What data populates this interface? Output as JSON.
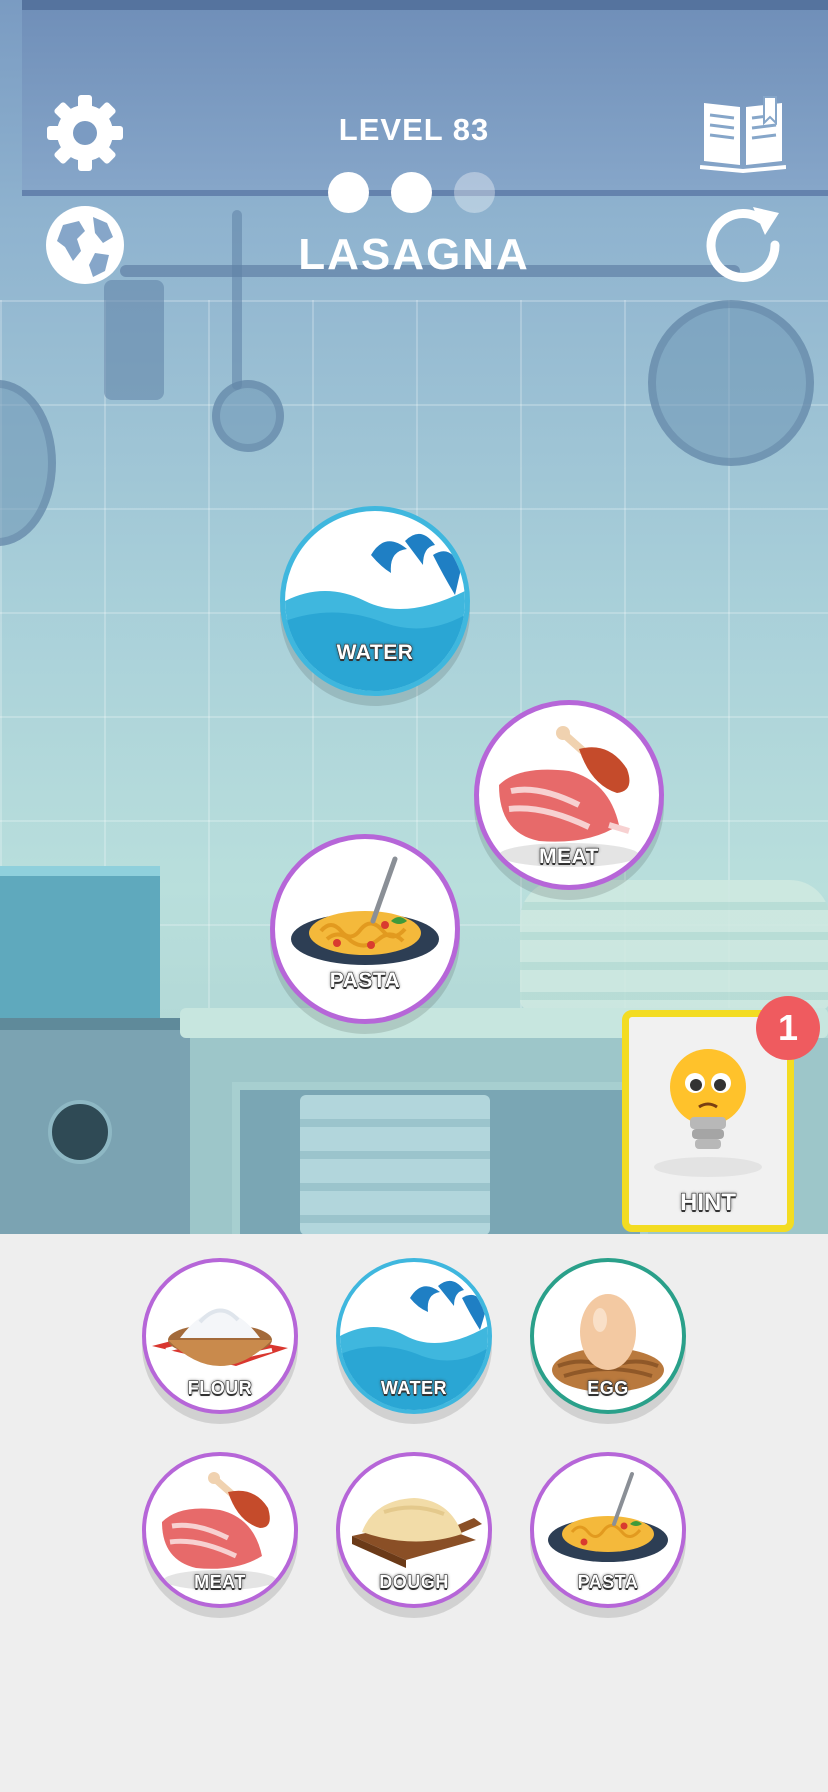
{
  "header": {
    "level_label": "LEVEL 83",
    "recipe_title": "LASAGNA",
    "progress": {
      "completed": 2,
      "total": 3
    }
  },
  "toolbar": {
    "settings_icon": "gear-icon",
    "language_icon": "globe-icon",
    "recipe_book_icon": "book-icon",
    "restart_icon": "restart-icon"
  },
  "board": {
    "items": [
      {
        "label": "WATER",
        "icon": "water-wave-icon"
      },
      {
        "label": "MEAT",
        "icon": "meat-icon"
      },
      {
        "label": "PASTA",
        "icon": "pasta-icon"
      }
    ]
  },
  "hint": {
    "label": "HINT",
    "count": "1",
    "icon": "lightbulb-icon"
  },
  "inventory": {
    "items": [
      {
        "label": "FLOUR",
        "icon": "flour-bowl-icon"
      },
      {
        "label": "WATER",
        "icon": "water-wave-icon"
      },
      {
        "label": "EGG",
        "icon": "egg-nest-icon"
      },
      {
        "label": "MEAT",
        "icon": "meat-icon"
      },
      {
        "label": "DOUGH",
        "icon": "dough-icon"
      },
      {
        "label": "PASTA",
        "icon": "pasta-icon"
      }
    ]
  },
  "colors": {
    "ring_purple": "#b666d8",
    "ring_teal": "#2aa08a",
    "ring_blue": "#3fb7de",
    "hint_border": "#f3dc22",
    "badge_red": "#ef5b5f"
  }
}
